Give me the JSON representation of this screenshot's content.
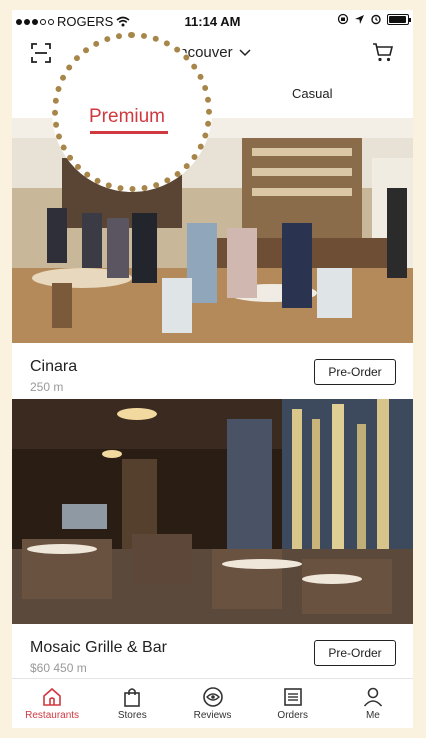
{
  "status_bar": {
    "carrier": "ROGERS",
    "time": "11:14 AM",
    "signal_filled": 3,
    "signal_empty": 2,
    "battery_level": 0.95
  },
  "header": {
    "city": "Vancouver",
    "icons": {
      "scan": "scan-icon",
      "dropdown": "chevron-down-icon",
      "cart": "cart-icon"
    }
  },
  "tabs": [
    {
      "label": "Premium",
      "active": true
    },
    {
      "label": "Casual",
      "active": false
    }
  ],
  "restaurants": [
    {
      "name": "Cinara",
      "meta": "250 m",
      "button": "Pre-Order"
    },
    {
      "name": "Mosaic Grille & Bar",
      "meta": "$60   450 m",
      "button": "Pre-Order"
    }
  ],
  "tabbar": [
    {
      "label": "Restaurants",
      "icon": "restaurant-icon",
      "active": true
    },
    {
      "label": "Stores",
      "icon": "shopping-bag-icon",
      "active": false
    },
    {
      "label": "Reviews",
      "icon": "eye-icon",
      "active": false
    },
    {
      "label": "Orders",
      "icon": "orders-list-icon",
      "active": false
    },
    {
      "label": "Me",
      "icon": "person-icon",
      "active": false
    }
  ],
  "colors": {
    "accent": "#d0393f",
    "spotlight_ring": "#a8864a",
    "background": "#fbf1df"
  }
}
